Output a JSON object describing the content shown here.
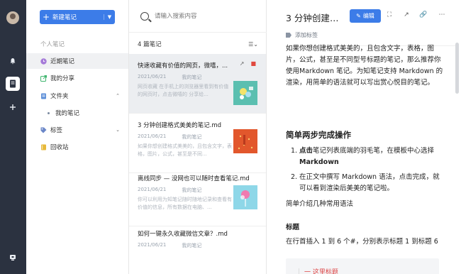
{
  "sidebar": {
    "new_note_label": "新建笔记",
    "section_title": "个人笔记",
    "items": [
      {
        "label": "近期笔记",
        "icon": "clock-icon",
        "color": "#a57ad8"
      },
      {
        "label": "我的分享",
        "icon": "share-icon",
        "color": "#3fb56e"
      },
      {
        "label": "文件夹",
        "icon": "folder-icon",
        "color": "#5d8fd8"
      },
      {
        "label": "我的笔记",
        "icon": "dot-icon"
      },
      {
        "label": "标签",
        "icon": "tag-icon",
        "color": "#6b87c8"
      },
      {
        "label": "回收站",
        "icon": "trash-icon",
        "color": "#e7b93a"
      }
    ]
  },
  "search": {
    "placeholder": "请输入搜索内容"
  },
  "list": {
    "count_label": "4 篇笔记",
    "notes": [
      {
        "title": "快速收藏有价值的网页，微嘻，...",
        "date": "2021/06/21",
        "folder": "我的笔记",
        "preview": "网页收藏 在手机上的浏览器里看到有价值的网页时，点击微嘻的 分享给..."
      },
      {
        "title": "3 分钟创建格式美美的笔记.md",
        "date": "2021/06/21",
        "folder": "我的笔记",
        "preview": "如果你想创建格式美美的，且包含文字，表格，图片，公式，甚至是不同..."
      },
      {
        "title": "离线同步 — 没网也可以随时查看笔记.md",
        "date": "2021/06/21",
        "folder": "我的笔记",
        "preview": "你可以利用为知笔记随时随地记录和查看有价值的信息，所有数据在电脑、..."
      },
      {
        "title": "如何一键永久收藏微信文章？.md",
        "date": "2021/06/21",
        "folder": "我的笔记",
        "preview": ""
      }
    ]
  },
  "editor": {
    "title": "3 分钟创建格...",
    "edit_label": "编辑",
    "tag_label": "添加标签",
    "intro": "如果你想创建格式美美的，且包含文字，表格，图片，公式，甚至是不同型号标题的笔记，那么推荐你使用Markdown 笔记。为知笔记支持 Markdown 的渲染，用简单的语法就可以写出赏心悦目的笔记。",
    "h2": "简单两步完成操作",
    "step1_prefix": "点击",
    "step1_rest": "笔记列表底端的羽毛笔，在模板中心选择",
    "step1_bold": "Markdown",
    "step2": "在正文中撰写 Markdown 语法，点击完成，就可以看到渲染后美美的笔记啦。",
    "p2": "简单介绍几种常用语法",
    "h3": "标题",
    "p3": "在行首插入 1 到 6 个#，分别表示标题 1 到标题 6",
    "code_text": "一 这里标题",
    "step_numbers": [
      "1.",
      "2."
    ]
  }
}
